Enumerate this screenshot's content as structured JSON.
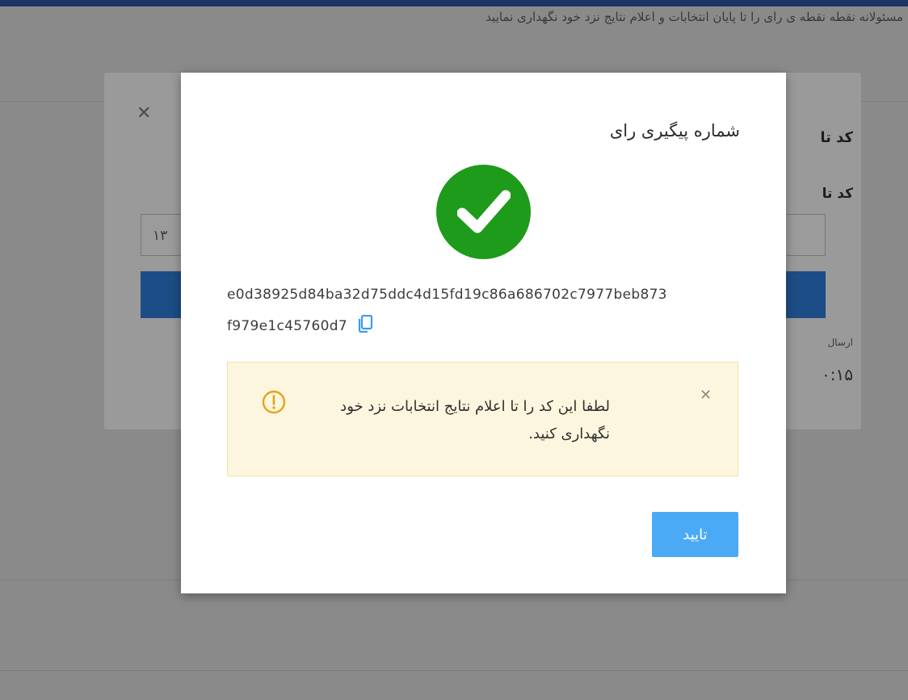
{
  "background": {
    "header_text": "مسئولانه نقطه نقطه ی رای را تا پایان انتخابات و اعلام نتایج نزد خود نگهداری نمایید"
  },
  "underlying_modal": {
    "title": "کد تا",
    "label": "کد تا",
    "input_value": "۱۳",
    "helper_text": "ارسال",
    "timer": "۰:۱۵"
  },
  "dialog": {
    "title": "شماره پیگیری رای",
    "hash_line_1": "e0d38925d84ba32d75ddc4d15fd19c86a686702c7977beb873",
    "hash_line_2": "f979e1c45760d7",
    "alert_text": "لطفا این کد را تا اعلام نتایج انتخابات نزد خود نگهداری کنید.",
    "confirm_label": "تایید"
  },
  "colors": {
    "success": "#1e9b1a",
    "primary": "#4baaf5",
    "warning_bg": "#fdf6de",
    "warning_icon": "#e8a21a"
  },
  "icons": {
    "success": "check-circle-icon",
    "copy": "copy-icon",
    "warning": "exclamation-circle-icon",
    "close": "close-icon"
  }
}
